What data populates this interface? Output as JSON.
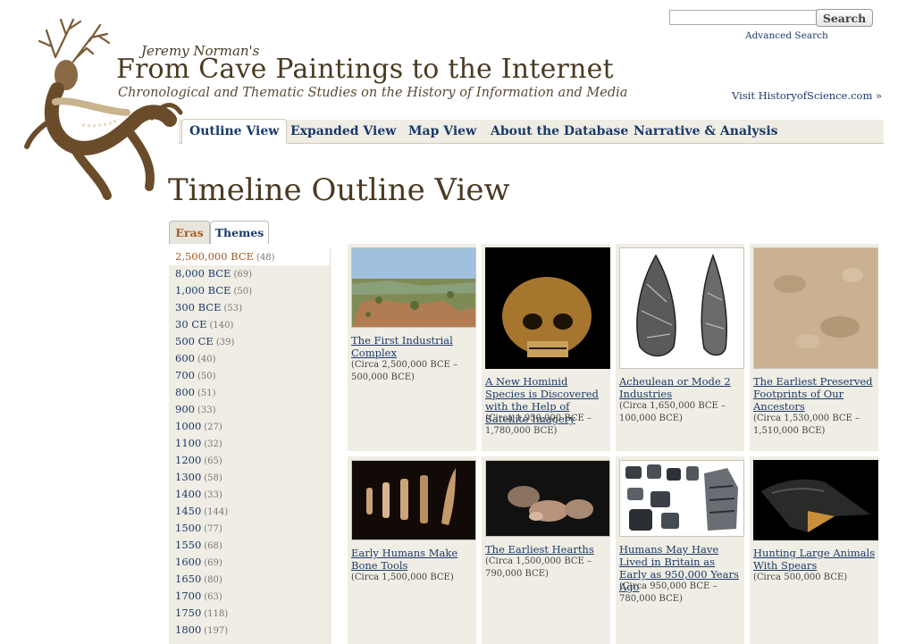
{
  "header": {
    "byline": "Jeremy Norman's",
    "title": "From Cave Paintings to the Internet",
    "subtitle": "Chronological and Thematic Studies on the History of Information and Media",
    "logo_icon": "cave-painting-figure-icon"
  },
  "search": {
    "value": "",
    "button_label": "Search",
    "advanced_link": "Advanced Search"
  },
  "visit_link": "Visit HistoryofScience.com »",
  "nav": {
    "tabs": [
      {
        "label": "Outline View",
        "active": true
      },
      {
        "label": "Expanded View",
        "active": false
      },
      {
        "label": "Map View",
        "active": false
      },
      {
        "label": "About the Database",
        "active": false
      },
      {
        "label": "Narrative & Analysis",
        "active": false
      }
    ]
  },
  "page_heading": "Timeline Outline View",
  "side_tabs": [
    {
      "label": "Eras",
      "active": true
    },
    {
      "label": "Themes",
      "active": false
    }
  ],
  "eras": [
    {
      "label": "2,500,000 BCE",
      "count": "(48)",
      "selected": true
    },
    {
      "label": "8,000 BCE",
      "count": "(69)"
    },
    {
      "label": "1,000 BCE",
      "count": "(50)"
    },
    {
      "label": "300 BCE",
      "count": "(53)"
    },
    {
      "label": "30 CE",
      "count": "(140)"
    },
    {
      "label": "500 CE",
      "count": "(39)"
    },
    {
      "label": "600",
      "count": "(40)"
    },
    {
      "label": "700",
      "count": "(50)"
    },
    {
      "label": "800",
      "count": "(51)"
    },
    {
      "label": "900",
      "count": "(33)"
    },
    {
      "label": "1000",
      "count": "(27)"
    },
    {
      "label": "1100",
      "count": "(32)"
    },
    {
      "label": "1200",
      "count": "(65)"
    },
    {
      "label": "1300",
      "count": "(58)"
    },
    {
      "label": "1400",
      "count": "(33)"
    },
    {
      "label": "1450",
      "count": "(144)"
    },
    {
      "label": "1500",
      "count": "(77)"
    },
    {
      "label": "1550",
      "count": "(68)"
    },
    {
      "label": "1600",
      "count": "(69)"
    },
    {
      "label": "1650",
      "count": "(80)"
    },
    {
      "label": "1700",
      "count": "(63)"
    },
    {
      "label": "1750",
      "count": "(118)"
    },
    {
      "label": "1800",
      "count": "(197)"
    }
  ],
  "cards": [
    {
      "title": "The First Industrial Complex",
      "date": "(Circa 2,500,000 BCE – 500,000 BCE)",
      "image": "landscape-photo"
    },
    {
      "title": "A New Hominid Species is Discovered with the Help of Satellite Imagery",
      "date": "(Circa 1,950,000 BCE – 1,780,000 BCE)",
      "image": "hominid-skull-photo"
    },
    {
      "title": "Acheulean or Mode 2 Industries",
      "date": "(Circa 1,650,000 BCE – 100,000 BCE)",
      "image": "hand-axe-drawing"
    },
    {
      "title": "The Earliest Preserved Footprints of Our Ancestors",
      "date": "(Circa 1,530,000 BCE – 1,510,000 BCE)",
      "image": "footprint-stone-photo"
    },
    {
      "title": "Early Humans Make Bone Tools",
      "date": "(Circa 1,500,000 BCE)",
      "image": "bone-tools-photo"
    },
    {
      "title": "The Earliest Hearths",
      "date": "(Circa 1,500,000 BCE – 790,000 BCE)",
      "image": "hearth-stones-photo"
    },
    {
      "title": "Humans May Have Lived in Britain as Early as 950,000 Years Ago",
      "date": "(Circa 950,000 BCE – 780,000 BCE)",
      "image": "flint-tools-photo"
    },
    {
      "title": "Hunting Large Animals With Spears",
      "date": "(Circa 500,000 BCE)",
      "image": "spear-point-photo"
    }
  ]
}
